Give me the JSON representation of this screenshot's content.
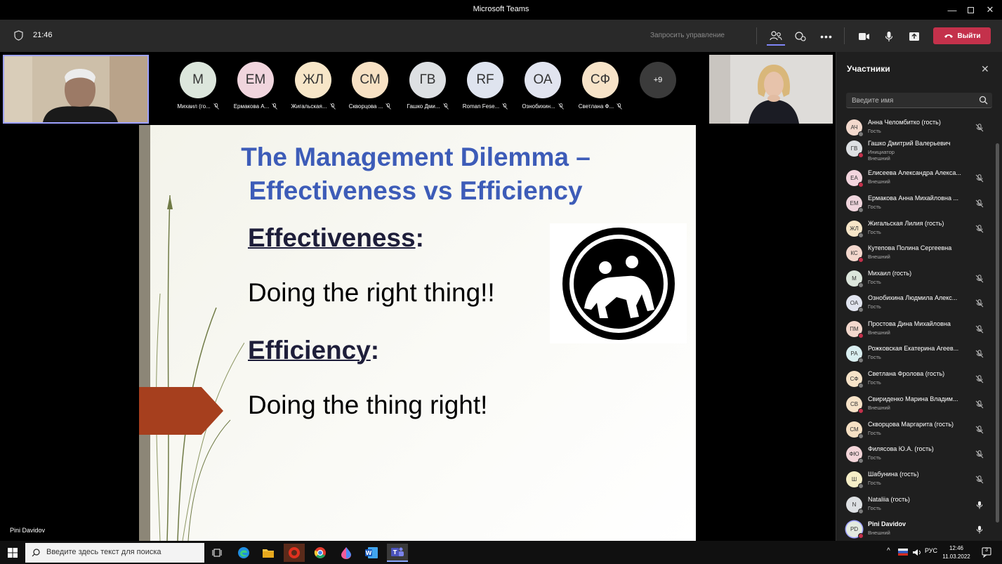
{
  "window": {
    "title": "Microsoft Teams"
  },
  "toolbar": {
    "time": "21:46",
    "request_control": "Запросить управление",
    "leave_label": "Выйти",
    "accent": "#c4314b"
  },
  "strip": {
    "participants": [
      {
        "initials": "М",
        "name": "Михаил (го...",
        "color": "#dce6dc"
      },
      {
        "initials": "ЕМ",
        "name": "Ермакова А...",
        "color": "#f0d5dd"
      },
      {
        "initials": "ЖЛ",
        "name": "Жигальская...",
        "color": "#f7e6c8"
      },
      {
        "initials": "СМ",
        "name": "Скворцова ...",
        "color": "#f7e1c4"
      },
      {
        "initials": "ГВ",
        "name": "Гашко Дми...",
        "color": "#dde0e3"
      },
      {
        "initials": "RF",
        "name": "Roman Fese...",
        "color": "#dfe4ef"
      },
      {
        "initials": "ОА",
        "name": "Ознобихин...",
        "color": "#e1e4ef"
      },
      {
        "initials": "СФ",
        "name": "Светлана Ф...",
        "color": "#f7e3c8"
      }
    ],
    "more": "+9"
  },
  "slide": {
    "title_line1": "The Management Dilemma –",
    "title_line2": "Effectiveness vs Efficiency",
    "h1": "Effectiveness",
    "h1_suffix": ":",
    "body1": "Doing the right thing!!",
    "h2": "Efficiency",
    "h2_suffix": ":",
    "body2": "Doing the thing right!"
  },
  "presenter": {
    "name": "Pini Davidov"
  },
  "panel": {
    "title": "Участники",
    "search_placeholder": "Введите имя",
    "rows": [
      {
        "initials": "АЧ",
        "name": "Анна Челомбитко (гость)",
        "sub": "Гость",
        "sub2": "",
        "color": "#f3d9cd",
        "mic": "off"
      },
      {
        "initials": "ГВ",
        "name": "Гашко Дмитрий Валерьевич",
        "sub": "Инициатор",
        "sub2": "Внешний",
        "color": "#dde0e3",
        "mic": "none"
      },
      {
        "initials": "ЕА",
        "name": "Елисеева Александра Алекса...",
        "sub": "Внешний",
        "sub2": "",
        "color": "#f3d5de",
        "mic": "off"
      },
      {
        "initials": "ЕМ",
        "name": "Ермакова Анна Михайловна ...",
        "sub": "Гость",
        "sub2": "",
        "color": "#f0d5dd",
        "mic": "off"
      },
      {
        "initials": "ЖЛ",
        "name": "Жигальская Лилия (гость)",
        "sub": "Гость",
        "sub2": "",
        "color": "#f7e6c8",
        "mic": "off"
      },
      {
        "initials": "КС",
        "name": "Кутепова Полина Сергеевна",
        "sub": "Внешний",
        "sub2": "",
        "color": "#f3d7cd",
        "mic": "none"
      },
      {
        "initials": "М",
        "name": "Михаил (гость)",
        "sub": "Гость",
        "sub2": "",
        "color": "#dce6dc",
        "mic": "off"
      },
      {
        "initials": "ОА",
        "name": "Ознобихина Людмила Алекс...",
        "sub": "Гость",
        "sub2": "",
        "color": "#e1e4ef",
        "mic": "off"
      },
      {
        "initials": "ПМ",
        "name": "Простова Дина Михайловна",
        "sub": "Внешний",
        "sub2": "",
        "color": "#f3d8cd",
        "mic": "off"
      },
      {
        "initials": "РА",
        "name": "Рожковская Екатерина Агеев...",
        "sub": "Гость",
        "sub2": "",
        "color": "#d9eef0",
        "mic": "off"
      },
      {
        "initials": "СФ",
        "name": "Светлана Фролова (гость)",
        "sub": "Гость",
        "sub2": "",
        "color": "#f7e3c8",
        "mic": "off"
      },
      {
        "initials": "СВ",
        "name": "Свириденко Марина Владим...",
        "sub": "Внешний",
        "sub2": "",
        "color": "#f7e3c8",
        "mic": "off"
      },
      {
        "initials": "СМ",
        "name": "Скворцова Маргарита (гость)",
        "sub": "Гость",
        "sub2": "",
        "color": "#f7e1c4",
        "mic": "off"
      },
      {
        "initials": "ФЮ",
        "name": "Филясова Ю.А. (гость)",
        "sub": "Гость",
        "sub2": "",
        "color": "#f3d5d9",
        "mic": "off"
      },
      {
        "initials": "Ш",
        "name": "Шабунина (гость)",
        "sub": "Гость",
        "sub2": "",
        "color": "#f7efc8",
        "mic": "off"
      },
      {
        "initials": "N",
        "name": "Nataliia (гость)",
        "sub": "Гость",
        "sub2": "",
        "color": "#dde0e3",
        "mic": "on"
      },
      {
        "initials": "PD",
        "name": "Pini Davidov",
        "sub": "Внешний",
        "sub2": "",
        "color": "#e4ebe0",
        "mic": "on"
      }
    ]
  },
  "taskbar": {
    "search_placeholder": "Введите здесь текст для поиска",
    "lang": "РУС",
    "time": "12:46",
    "date": "11.03.2022",
    "notifications": "3"
  }
}
